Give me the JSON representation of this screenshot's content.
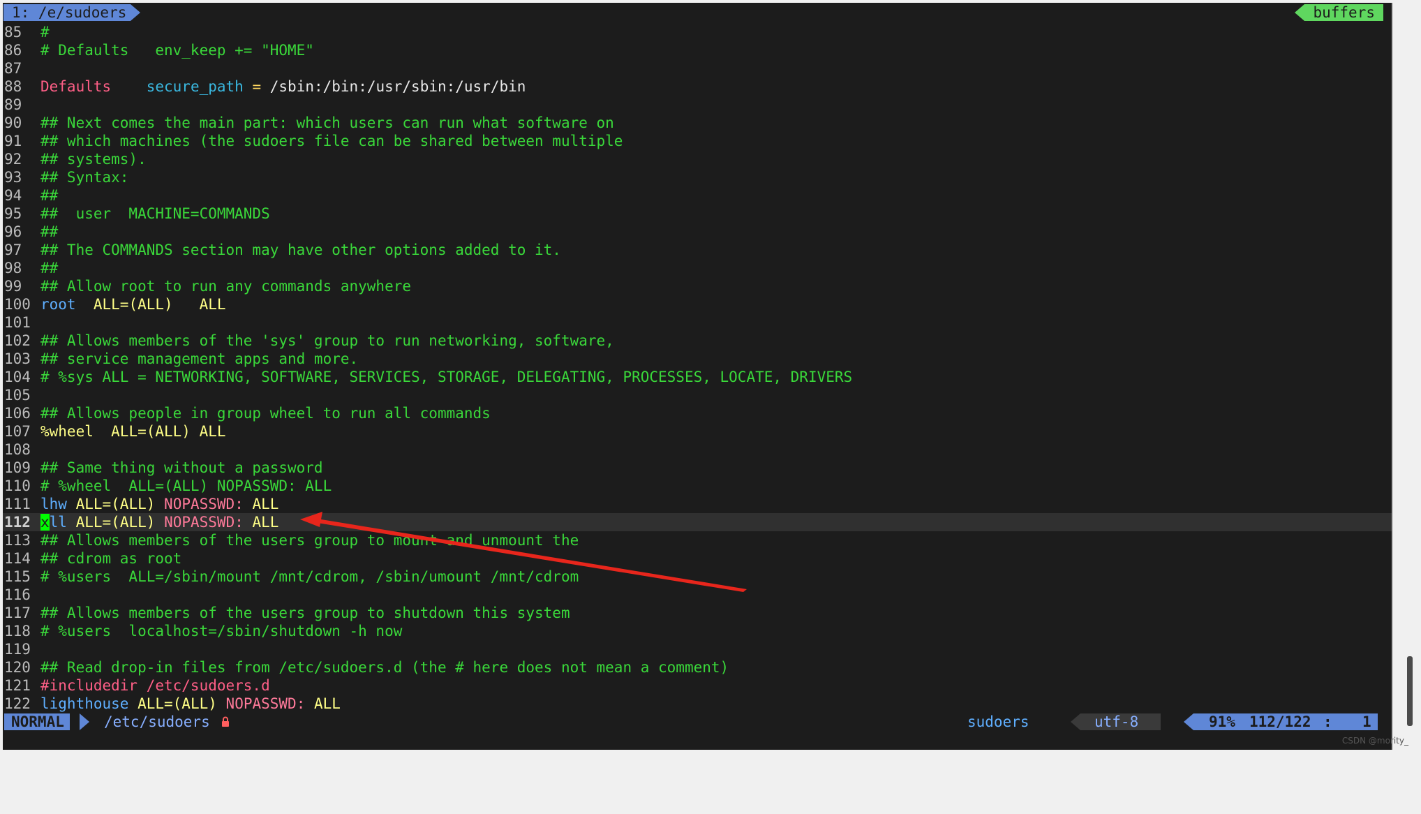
{
  "tabline": {
    "active_tab": "1: /e/sudoers",
    "right_label": "buffers"
  },
  "lines": [
    {
      "num": "85",
      "tokens": [
        {
          "t": "#",
          "c": "cm"
        }
      ]
    },
    {
      "num": "86",
      "tokens": [
        {
          "t": "# Defaults   env_keep += \"HOME\"",
          "c": "cm"
        }
      ]
    },
    {
      "num": "87",
      "tokens": []
    },
    {
      "num": "88",
      "tokens": [
        {
          "t": "Defaults",
          "c": "kw"
        },
        {
          "t": "    ",
          "c": "val"
        },
        {
          "t": "secure_path",
          "c": "id"
        },
        {
          "t": " ",
          "c": "val"
        },
        {
          "t": "=",
          "c": "op"
        },
        {
          "t": " /sbin:/bin:/usr/sbin:/usr/bin",
          "c": "path"
        }
      ]
    },
    {
      "num": "89",
      "tokens": []
    },
    {
      "num": "90",
      "tokens": [
        {
          "t": "## Next comes the main part: which users can run what software on",
          "c": "cm"
        }
      ]
    },
    {
      "num": "91",
      "tokens": [
        {
          "t": "## which machines (the sudoers file can be shared between multiple",
          "c": "cm"
        }
      ]
    },
    {
      "num": "92",
      "tokens": [
        {
          "t": "## systems).",
          "c": "cm"
        }
      ]
    },
    {
      "num": "93",
      "tokens": [
        {
          "t": "## Syntax:",
          "c": "cm"
        }
      ]
    },
    {
      "num": "94",
      "tokens": [
        {
          "t": "##",
          "c": "cm"
        }
      ]
    },
    {
      "num": "95",
      "tokens": [
        {
          "t": "##  user  MACHINE=COMMANDS",
          "c": "cm"
        }
      ]
    },
    {
      "num": "96",
      "tokens": [
        {
          "t": "##",
          "c": "cm"
        }
      ]
    },
    {
      "num": "97",
      "tokens": [
        {
          "t": "## The COMMANDS section may have other options added to it.",
          "c": "cm"
        }
      ]
    },
    {
      "num": "98",
      "tokens": [
        {
          "t": "##",
          "c": "cm"
        }
      ]
    },
    {
      "num": "99",
      "tokens": [
        {
          "t": "## Allow root to run any commands anywhere",
          "c": "cm"
        }
      ]
    },
    {
      "num": "100",
      "tokens": [
        {
          "t": "root",
          "c": "user"
        },
        {
          "t": "  ",
          "c": "val"
        },
        {
          "t": "ALL=(ALL)",
          "c": "all"
        },
        {
          "t": "   ",
          "c": "val"
        },
        {
          "t": "ALL",
          "c": "all"
        }
      ]
    },
    {
      "num": "101",
      "tokens": []
    },
    {
      "num": "102",
      "tokens": [
        {
          "t": "## Allows members of the 'sys' group to run networking, software,",
          "c": "cm"
        }
      ]
    },
    {
      "num": "103",
      "tokens": [
        {
          "t": "## service management apps and more.",
          "c": "cm"
        }
      ]
    },
    {
      "num": "104",
      "tokens": [
        {
          "t": "# %sys ALL = NETWORKING, SOFTWARE, SERVICES, STORAGE, DELEGATING, PROCESSES, LOCATE, DRIVERS",
          "c": "cm"
        }
      ]
    },
    {
      "num": "105",
      "tokens": []
    },
    {
      "num": "106",
      "tokens": [
        {
          "t": "## Allows people in group wheel to run all commands",
          "c": "cm"
        }
      ]
    },
    {
      "num": "107",
      "tokens": [
        {
          "t": "%wheel",
          "c": "all"
        },
        {
          "t": "  ",
          "c": "val"
        },
        {
          "t": "ALL=(ALL) ALL",
          "c": "all"
        }
      ]
    },
    {
      "num": "108",
      "tokens": []
    },
    {
      "num": "109",
      "tokens": [
        {
          "t": "## Same thing without a password",
          "c": "cm"
        }
      ]
    },
    {
      "num": "110",
      "tokens": [
        {
          "t": "# %wheel  ALL=(ALL) NOPASSWD: ALL",
          "c": "cm"
        }
      ]
    },
    {
      "num": "111",
      "tokens": [
        {
          "t": "lhw",
          "c": "user"
        },
        {
          "t": " ",
          "c": "val"
        },
        {
          "t": "ALL=(ALL)",
          "c": "all"
        },
        {
          "t": " ",
          "c": "val"
        },
        {
          "t": "NOPASSWD:",
          "c": "pw"
        },
        {
          "t": " ALL",
          "c": "all"
        }
      ]
    },
    {
      "num": "112",
      "current": true,
      "tokens": [
        {
          "t": "x",
          "c": "cursor"
        },
        {
          "t": "ll",
          "c": "user"
        },
        {
          "t": " ",
          "c": "val"
        },
        {
          "t": "ALL=(ALL)",
          "c": "all"
        },
        {
          "t": " ",
          "c": "val"
        },
        {
          "t": "NOPASSWD:",
          "c": "pw"
        },
        {
          "t": " ALL",
          "c": "all"
        }
      ]
    },
    {
      "num": "113",
      "tokens": [
        {
          "t": "## Allows members of the users group to mount and unmount the",
          "c": "cm"
        }
      ]
    },
    {
      "num": "114",
      "tokens": [
        {
          "t": "## cdrom as root",
          "c": "cm"
        }
      ]
    },
    {
      "num": "115",
      "tokens": [
        {
          "t": "# %users  ALL=/sbin/mount /mnt/cdrom, /sbin/umount /mnt/cdrom",
          "c": "cm"
        }
      ]
    },
    {
      "num": "116",
      "tokens": []
    },
    {
      "num": "117",
      "tokens": [
        {
          "t": "## Allows members of the users group to shutdown this system",
          "c": "cm"
        }
      ]
    },
    {
      "num": "118",
      "tokens": [
        {
          "t": "# %users  localhost=/sbin/shutdown -h now",
          "c": "cm"
        }
      ]
    },
    {
      "num": "119",
      "tokens": []
    },
    {
      "num": "120",
      "tokens": [
        {
          "t": "## Read drop-in files from /etc/sudoers.d (the # here does not mean a comment)",
          "c": "cm"
        }
      ]
    },
    {
      "num": "121",
      "tokens": [
        {
          "t": "#includedir /etc/sudoers.d",
          "c": "kw"
        }
      ]
    },
    {
      "num": "122",
      "tokens": [
        {
          "t": "lighthouse",
          "c": "user"
        },
        {
          "t": " ",
          "c": "val"
        },
        {
          "t": "ALL=(ALL)",
          "c": "all"
        },
        {
          "t": " ",
          "c": "val"
        },
        {
          "t": "NOPASSWD:",
          "c": "pw"
        },
        {
          "t": " ALL",
          "c": "all"
        }
      ]
    }
  ],
  "statusline": {
    "mode": "NORMAL",
    "file": "/etc/sudoers",
    "lock_icon": "lock-icon",
    "filetype": "sudoers",
    "encoding": "utf-8",
    "percent": "91%",
    "position": "112/122",
    "sep": ":",
    "column": "1"
  },
  "watermark": "CSDN @mority_",
  "colors": {
    "background": "#1c1c1c",
    "comment": "#3ad83a",
    "keyword": "#ff5f87",
    "mode_bg": "#5f87d7",
    "buffers_bg": "#5fd75f",
    "cursor": "#00ff00",
    "annotation_arrow": "#e8261c"
  }
}
